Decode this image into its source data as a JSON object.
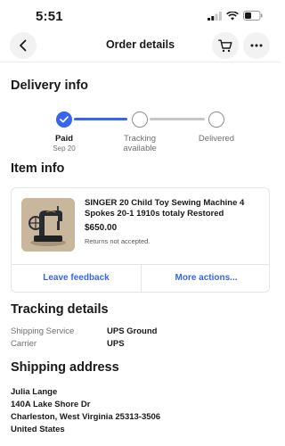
{
  "status_bar": {
    "time": "5:51",
    "icons": [
      "signal-icon",
      "wifi-icon",
      "battery-icon"
    ]
  },
  "nav": {
    "title": "Order details",
    "back_icon": "chevron-left-icon",
    "cart_icon": "cart-icon",
    "more_icon": "ellipsis-icon"
  },
  "delivery": {
    "title": "Delivery info",
    "steps": [
      {
        "label": "Paid",
        "sub": "Sep 20",
        "done": true
      },
      {
        "label": "Tracking\navailable",
        "sub": "",
        "done": false
      },
      {
        "label": "Delivered",
        "sub": "",
        "done": false
      }
    ],
    "accent": "#3665f3"
  },
  "item": {
    "title": "Item info",
    "name": "SINGER 20 Child Toy Sewing Machine 4 Spokes 20-1 1910s totaly Restored",
    "price": "$650.00",
    "returns": "Returns not accepted.",
    "actions": {
      "feedback": "Leave feedback",
      "more": "More actions..."
    }
  },
  "tracking": {
    "title": "Tracking details",
    "rows": [
      {
        "label": "Shipping Service",
        "value": "UPS Ground"
      },
      {
        "label": "Carrier",
        "value": "UPS"
      }
    ]
  },
  "shipping": {
    "title": "Shipping address",
    "lines": [
      "Julia Lange",
      "140A Lake Shore Dr",
      "Charleston, West Virginia 25313-3506",
      "United States"
    ]
  }
}
